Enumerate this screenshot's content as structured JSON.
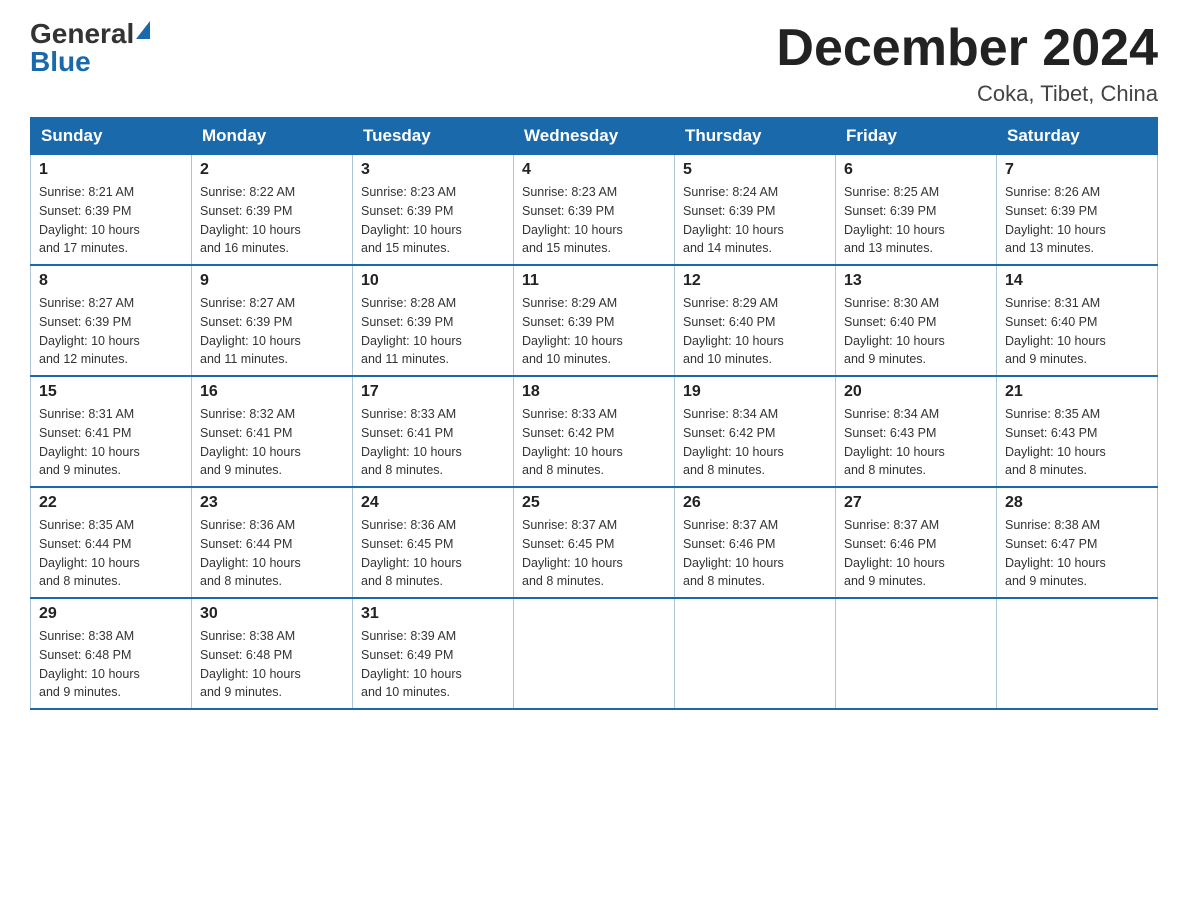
{
  "logo": {
    "general": "General",
    "blue": "Blue"
  },
  "title": "December 2024",
  "location": "Coka, Tibet, China",
  "days_of_week": [
    "Sunday",
    "Monday",
    "Tuesday",
    "Wednesday",
    "Thursday",
    "Friday",
    "Saturday"
  ],
  "weeks": [
    [
      {
        "day": "1",
        "sunrise": "8:21 AM",
        "sunset": "6:39 PM",
        "daylight": "10 hours and 17 minutes."
      },
      {
        "day": "2",
        "sunrise": "8:22 AM",
        "sunset": "6:39 PM",
        "daylight": "10 hours and 16 minutes."
      },
      {
        "day": "3",
        "sunrise": "8:23 AM",
        "sunset": "6:39 PM",
        "daylight": "10 hours and 15 minutes."
      },
      {
        "day": "4",
        "sunrise": "8:23 AM",
        "sunset": "6:39 PM",
        "daylight": "10 hours and 15 minutes."
      },
      {
        "day": "5",
        "sunrise": "8:24 AM",
        "sunset": "6:39 PM",
        "daylight": "10 hours and 14 minutes."
      },
      {
        "day": "6",
        "sunrise": "8:25 AM",
        "sunset": "6:39 PM",
        "daylight": "10 hours and 13 minutes."
      },
      {
        "day": "7",
        "sunrise": "8:26 AM",
        "sunset": "6:39 PM",
        "daylight": "10 hours and 13 minutes."
      }
    ],
    [
      {
        "day": "8",
        "sunrise": "8:27 AM",
        "sunset": "6:39 PM",
        "daylight": "10 hours and 12 minutes."
      },
      {
        "day": "9",
        "sunrise": "8:27 AM",
        "sunset": "6:39 PM",
        "daylight": "10 hours and 11 minutes."
      },
      {
        "day": "10",
        "sunrise": "8:28 AM",
        "sunset": "6:39 PM",
        "daylight": "10 hours and 11 minutes."
      },
      {
        "day": "11",
        "sunrise": "8:29 AM",
        "sunset": "6:39 PM",
        "daylight": "10 hours and 10 minutes."
      },
      {
        "day": "12",
        "sunrise": "8:29 AM",
        "sunset": "6:40 PM",
        "daylight": "10 hours and 10 minutes."
      },
      {
        "day": "13",
        "sunrise": "8:30 AM",
        "sunset": "6:40 PM",
        "daylight": "10 hours and 9 minutes."
      },
      {
        "day": "14",
        "sunrise": "8:31 AM",
        "sunset": "6:40 PM",
        "daylight": "10 hours and 9 minutes."
      }
    ],
    [
      {
        "day": "15",
        "sunrise": "8:31 AM",
        "sunset": "6:41 PM",
        "daylight": "10 hours and 9 minutes."
      },
      {
        "day": "16",
        "sunrise": "8:32 AM",
        "sunset": "6:41 PM",
        "daylight": "10 hours and 9 minutes."
      },
      {
        "day": "17",
        "sunrise": "8:33 AM",
        "sunset": "6:41 PM",
        "daylight": "10 hours and 8 minutes."
      },
      {
        "day": "18",
        "sunrise": "8:33 AM",
        "sunset": "6:42 PM",
        "daylight": "10 hours and 8 minutes."
      },
      {
        "day": "19",
        "sunrise": "8:34 AM",
        "sunset": "6:42 PM",
        "daylight": "10 hours and 8 minutes."
      },
      {
        "day": "20",
        "sunrise": "8:34 AM",
        "sunset": "6:43 PM",
        "daylight": "10 hours and 8 minutes."
      },
      {
        "day": "21",
        "sunrise": "8:35 AM",
        "sunset": "6:43 PM",
        "daylight": "10 hours and 8 minutes."
      }
    ],
    [
      {
        "day": "22",
        "sunrise": "8:35 AM",
        "sunset": "6:44 PM",
        "daylight": "10 hours and 8 minutes."
      },
      {
        "day": "23",
        "sunrise": "8:36 AM",
        "sunset": "6:44 PM",
        "daylight": "10 hours and 8 minutes."
      },
      {
        "day": "24",
        "sunrise": "8:36 AM",
        "sunset": "6:45 PM",
        "daylight": "10 hours and 8 minutes."
      },
      {
        "day": "25",
        "sunrise": "8:37 AM",
        "sunset": "6:45 PM",
        "daylight": "10 hours and 8 minutes."
      },
      {
        "day": "26",
        "sunrise": "8:37 AM",
        "sunset": "6:46 PM",
        "daylight": "10 hours and 8 minutes."
      },
      {
        "day": "27",
        "sunrise": "8:37 AM",
        "sunset": "6:46 PM",
        "daylight": "10 hours and 9 minutes."
      },
      {
        "day": "28",
        "sunrise": "8:38 AM",
        "sunset": "6:47 PM",
        "daylight": "10 hours and 9 minutes."
      }
    ],
    [
      {
        "day": "29",
        "sunrise": "8:38 AM",
        "sunset": "6:48 PM",
        "daylight": "10 hours and 9 minutes."
      },
      {
        "day": "30",
        "sunrise": "8:38 AM",
        "sunset": "6:48 PM",
        "daylight": "10 hours and 9 minutes."
      },
      {
        "day": "31",
        "sunrise": "8:39 AM",
        "sunset": "6:49 PM",
        "daylight": "10 hours and 10 minutes."
      },
      null,
      null,
      null,
      null
    ]
  ],
  "labels": {
    "sunrise": "Sunrise:",
    "sunset": "Sunset:",
    "daylight": "Daylight:"
  }
}
